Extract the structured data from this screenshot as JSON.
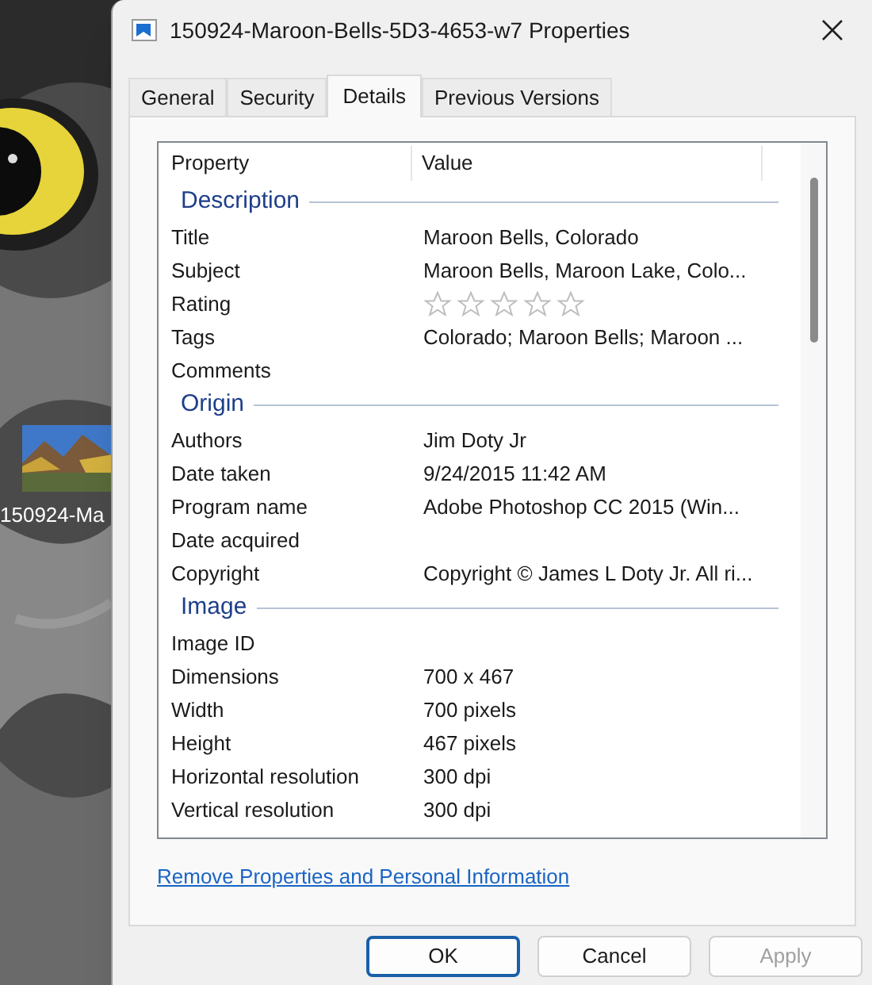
{
  "desktop": {
    "icon_label": "150924-Ma"
  },
  "window": {
    "title": "150924-Maroon-Bells-5D3-4653-w7 Properties"
  },
  "tabs": [
    {
      "label": "General",
      "selected": false
    },
    {
      "label": "Security",
      "selected": false
    },
    {
      "label": "Details",
      "selected": true
    },
    {
      "label": "Previous Versions",
      "selected": false
    }
  ],
  "details": {
    "columns": [
      "Property",
      "Value"
    ],
    "groups": [
      {
        "name": "Description",
        "rows": [
          {
            "property": "Title",
            "value": "Maroon Bells, Colorado"
          },
          {
            "property": "Subject",
            "value": "Maroon Bells, Maroon Lake, Colo..."
          },
          {
            "property": "Rating",
            "kind": "stars",
            "stars": 0
          },
          {
            "property": "Tags",
            "value": "Colorado; Maroon Bells; Maroon ..."
          },
          {
            "property": "Comments"
          }
        ]
      },
      {
        "name": "Origin",
        "rows": [
          {
            "property": "Authors",
            "value": "Jim Doty Jr"
          },
          {
            "property": "Date taken",
            "value": "9/24/2015 11:42 AM"
          },
          {
            "property": "Program name",
            "value": "Adobe Photoshop CC 2015 (Win..."
          },
          {
            "property": "Date acquired"
          },
          {
            "property": "Copyright",
            "value": "Copyright © James L Doty Jr. All ri..."
          }
        ]
      },
      {
        "name": "Image",
        "rows": [
          {
            "property": "Image ID"
          },
          {
            "property": "Dimensions",
            "value": "700 x 467"
          },
          {
            "property": "Width",
            "value": "700 pixels"
          },
          {
            "property": "Height",
            "value": "467 pixels"
          },
          {
            "property": "Horizontal resolution",
            "value": "300 dpi"
          },
          {
            "property": "Vertical resolution",
            "value": "300 dpi"
          }
        ]
      }
    ]
  },
  "link": "Remove Properties and Personal Information",
  "buttons": [
    {
      "label": "OK",
      "default": true,
      "disabled": false
    },
    {
      "label": "Cancel",
      "default": false,
      "disabled": false
    },
    {
      "label": "Apply",
      "default": false,
      "disabled": true
    }
  ]
}
